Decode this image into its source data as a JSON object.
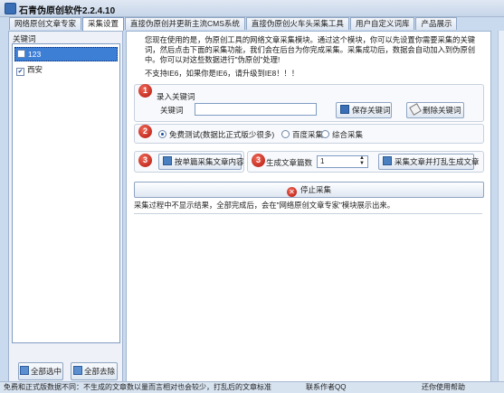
{
  "app": {
    "title": "石青伪原创软件2.2.4.10"
  },
  "tabs": [
    {
      "label": "网络原创文章专家"
    },
    {
      "label": "采集设置"
    },
    {
      "label": "直接伪原创并更新主流CMS系统"
    },
    {
      "label": "直接伪原创火车头采集工具"
    },
    {
      "label": "用户自定义词库"
    },
    {
      "label": "产品展示"
    }
  ],
  "sidebar": {
    "label": "关键词",
    "items": [
      {
        "label": "123",
        "checked": false,
        "selected": true
      },
      {
        "label": "西安",
        "checked": true,
        "selected": false
      }
    ],
    "select_all_label": "全部选中",
    "remove_all_label": "全部去除"
  },
  "main": {
    "intro": "您现在使用的是，伪原创工具的网络文章采集模块。通过这个模块，你可以先设置你需要采集的关键词，然后点击下面的采集功能，我们会在后台为你完成采集。采集成功后，数据会自动加入到伪原创中。你可以对这些数据进行\"伪原创\"处理!",
    "warning": "不支持IE6，如果你是IE6，请升级到IE8！！！",
    "step1": {
      "badge": "1",
      "title": "录入关键词",
      "field_label": "关键词",
      "field_value": "",
      "save_label": "保存关键词",
      "delete_label": "删除关键词"
    },
    "step2": {
      "badge": "2",
      "options": [
        {
          "label": "免费测试(数据比正式版少很多)",
          "selected": true
        },
        {
          "label": "百度采集",
          "selected": false
        },
        {
          "label": "综合采集",
          "selected": false
        }
      ]
    },
    "step3": {
      "badge_a": "3",
      "single_label": "按单篇采集文章内容",
      "badge_b": "3",
      "count_label": "生成文章篇数",
      "count_value": "1",
      "multi_label": "采集文章并打乱生成文章"
    },
    "stop_label": "停止采集",
    "note": "采集过程中不显示结果，全部完成后，会在\"网络原创文章专家\"模块展示出来。"
  },
  "status": {
    "left": "免费和正式版数据不同：不生成的文章数以量而言相对也会较少，打乱后的文章标准",
    "middle": "联系作者QQ",
    "right": "还你使用帮助"
  },
  "colors": {
    "accent": "#3e7fd6",
    "badge": "#c41d10",
    "frame": "#c9d9ee"
  }
}
